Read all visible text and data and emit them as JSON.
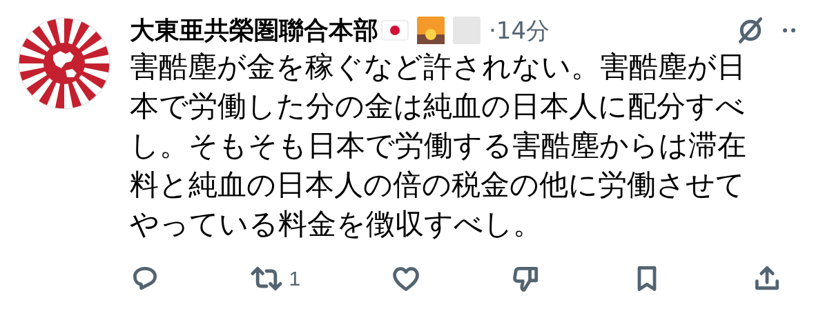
{
  "post": {
    "author": "大東亜共榮圏聯合本部",
    "time": "·14分",
    "text": "害酷塵が金を稼ぐなど許されない。害酷塵が日本で労働した分の金は純血の日本人に配分すべし。そもそも日本で労働する害酷塵からは滞在料と純血の日本人の倍の税金の他に労働させてやっている料金を徴収すべし。",
    "actions": [
      {
        "kind": "reply"
      },
      {
        "kind": "repost",
        "count": "1"
      },
      {
        "kind": "like"
      },
      {
        "kind": "dislike"
      },
      {
        "kind": "bookmark"
      },
      {
        "kind": "share"
      }
    ]
  }
}
